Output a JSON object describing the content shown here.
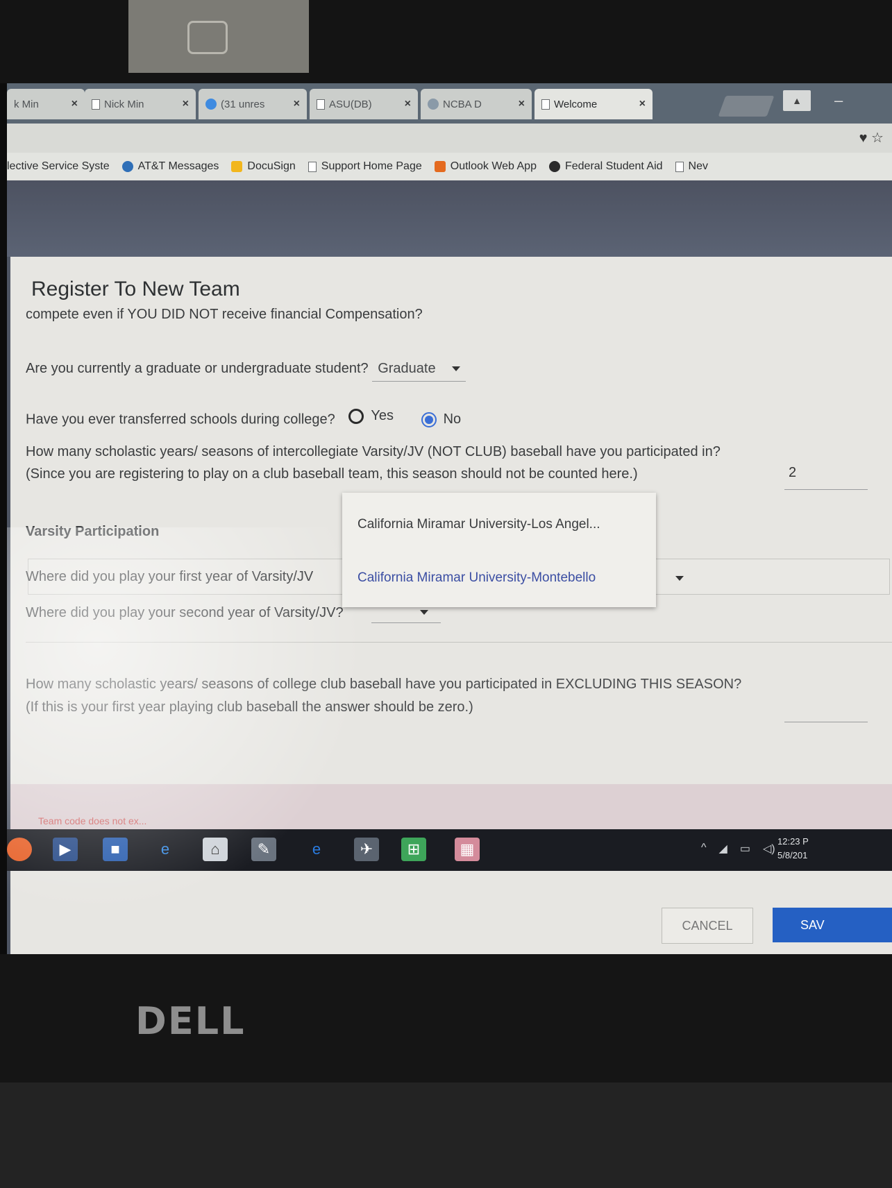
{
  "browser": {
    "tabs": [
      {
        "label": "k Min"
      },
      {
        "label": "Nick Min"
      },
      {
        "label": "(31 unres"
      },
      {
        "label": "ASU(DB)"
      },
      {
        "label": "NCBA D"
      },
      {
        "label": "Welcome"
      }
    ],
    "tab_close": "×",
    "toolbar_icons": "♥ ☆"
  },
  "bookmarks": [
    {
      "label": "lective Service Syste"
    },
    {
      "label": "AT&T Messages"
    },
    {
      "label": "DocuSign"
    },
    {
      "label": "Support Home Page"
    },
    {
      "label": "Outlook Web App"
    },
    {
      "label": "Federal Student Aid"
    },
    {
      "label": "Nev"
    }
  ],
  "dialog": {
    "title": "Register To New Team",
    "q_compensation": "compete even if YOU DID NOT receive financial Compensation?",
    "q_student": "Are you currently a graduate or undergraduate student?",
    "student_value": "Graduate",
    "q_transfer": "Have you ever transferred schools during college?",
    "transfer_yes": "Yes",
    "transfer_no": "No",
    "q_varsity_years": "How many scholastic years/ seasons of intercollegiate Varsity/JV (NOT CLUB) baseball have you participated in?",
    "q_varsity_note": "(Since you are registering to play on a club baseball team, this season should not be counted here.)",
    "varsity_years_value": "2",
    "section_label": "Varsity Participation",
    "q_first_year": "Where did you play your first year of Varsity/JV",
    "first_year_value": "California Miramar University-Montebello",
    "q_second_year": "Where did you play your second year of Varsity/JV?",
    "q_club_years": "How many scholastic years/ seasons of college club baseball have you participated in EXCLUDING THIS SEASON?",
    "q_club_note": "(If this is your first year playing club baseball the answer should be zero.)",
    "dropdown_options": [
      "California Miramar University-Los Angel...",
      "California Miramar University-Montebello"
    ],
    "error": "Team code does not ex...",
    "cancel_label": "CANCEL",
    "save_label": "SAV"
  },
  "taskbar": {
    "time": "12:23 P",
    "date": "5/8/201"
  },
  "laptop_brand": "DELL"
}
